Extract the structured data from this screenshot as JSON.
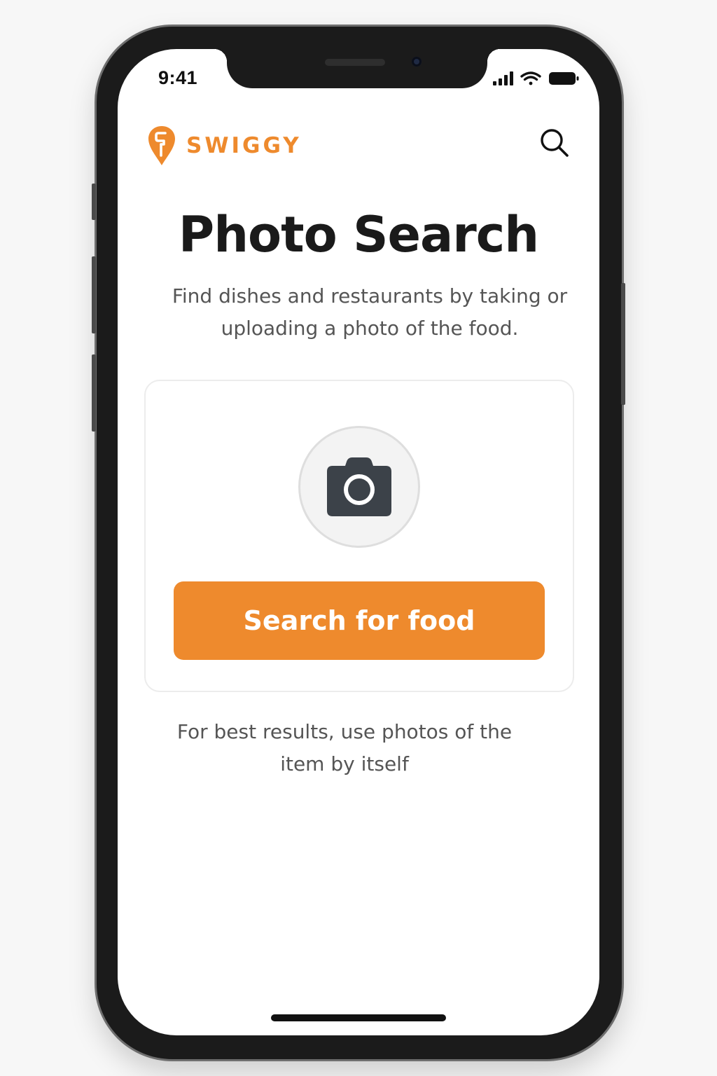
{
  "status_bar": {
    "time": "9:41",
    "icons": [
      "signal-icon",
      "wifi-icon",
      "battery-icon"
    ]
  },
  "header": {
    "brand": "SWIGGY",
    "brand_color": "#ee8a2d",
    "logo_icon": "swiggy-logo-icon",
    "search_icon": "search-icon"
  },
  "main": {
    "title": "Photo Search",
    "subtitle": "Find dishes and restaurants by taking or uploading a photo of the food.",
    "card": {
      "camera_icon": "camera-icon",
      "button_label": "Search for food",
      "button_color": "#ee8a2d"
    },
    "hint": "For best results, use photos of the item by itself"
  }
}
